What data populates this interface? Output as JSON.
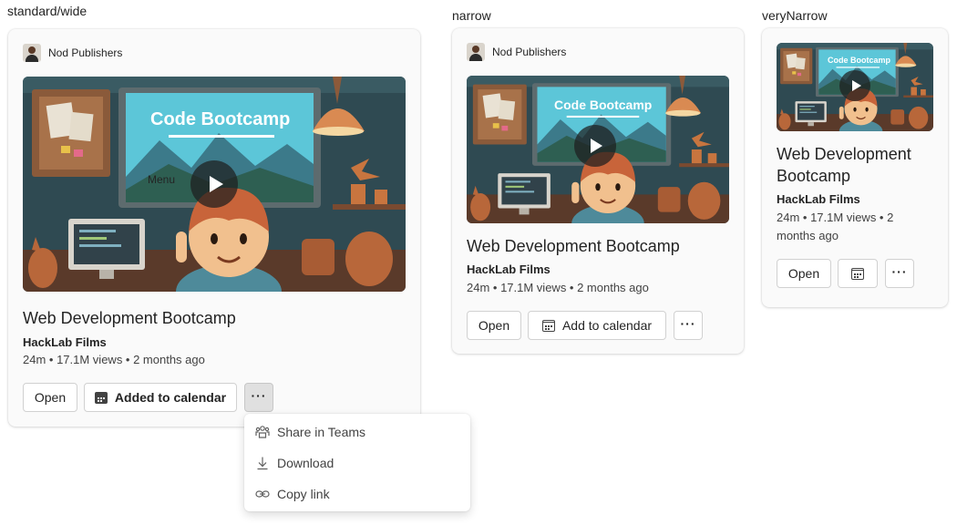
{
  "variants": {
    "standard": {
      "label": "standard/wide"
    },
    "narrow": {
      "label": "narrow"
    },
    "very_narrow": {
      "label": "veryNarrow"
    }
  },
  "card": {
    "publisher": "Nod Publishers",
    "thumbnail_text": "Code Bootcamp",
    "title": "Web Development Bootcamp",
    "channel": "HackLab Films",
    "meta": "24m • 17.1M views • 2 months ago",
    "meta_wrapped_line1": "24m • 17.1M views • 2",
    "meta_wrapped_line2": "months ago",
    "open_label": "Open",
    "added_to_calendar_label": "Added to calendar",
    "add_to_calendar_label": "Add to calendar",
    "more_label": "···",
    "menu_tooltip": "Menu"
  },
  "more_menu": {
    "items": [
      {
        "label": "Share in Teams",
        "icon": "teams-icon"
      },
      {
        "label": "Download",
        "icon": "download-icon"
      },
      {
        "label": "Copy link",
        "icon": "link-icon"
      }
    ]
  },
  "colors": {
    "card_bg": "#fafafa",
    "button_border": "#d1d1d1",
    "pressed_button": "#e0e0e0",
    "thumbnail_screen": "#4cc4d8",
    "thumbnail_wall": "#2f4a52",
    "thumbnail_clay": "#c8753f"
  }
}
